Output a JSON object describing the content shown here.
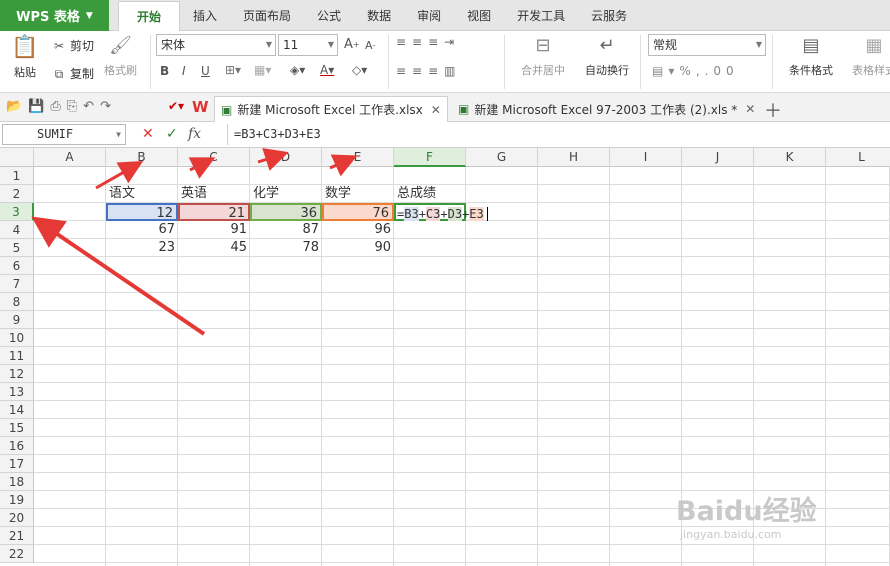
{
  "app": {
    "name": "WPS 表格",
    "menu_tabs": [
      "开始",
      "插入",
      "页面布局",
      "公式",
      "数据",
      "审阅",
      "视图",
      "开发工具",
      "云服务"
    ],
    "active_tab": "开始"
  },
  "ribbon": {
    "paste": "粘贴",
    "cut": "剪切",
    "copy": "复制",
    "format_painter": "格式刷",
    "font_name": "宋体",
    "font_size": "11",
    "merge_center": "合并居中",
    "wrap_text": "自动换行",
    "number_format": "常规",
    "conditional_format": "条件格式",
    "table_style": "表格样式"
  },
  "doc_tabs": [
    {
      "label": "新建 Microsoft Excel 工作表.xlsx",
      "active": true
    },
    {
      "label": "新建 Microsoft Excel 97-2003 工作表 (2).xls *",
      "active": false
    }
  ],
  "formula_bar": {
    "name_box": "SUMIF",
    "formula": "=B3+C3+D3+E3"
  },
  "columns": [
    "A",
    "B",
    "C",
    "D",
    "E",
    "F",
    "G",
    "H",
    "I",
    "J",
    "K",
    "L"
  ],
  "rows": [
    "1",
    "2",
    "3",
    "4",
    "5",
    "6",
    "7",
    "8",
    "9",
    "10",
    "11",
    "12",
    "13",
    "14",
    "15",
    "16",
    "17",
    "18",
    "19",
    "20",
    "21",
    "22"
  ],
  "sheet": {
    "headers": [
      "语文",
      "英语",
      "化学",
      "数学",
      "总成绩"
    ],
    "data": [
      [
        "12",
        "21",
        "36",
        "76"
      ],
      [
        "67",
        "91",
        "87",
        "96"
      ],
      [
        "23",
        "45",
        "78",
        "90"
      ]
    ],
    "editing_formula": {
      "eq": "=",
      "b": "B3",
      "c": "C3",
      "d": "D3",
      "e": "E3",
      "plus": "+"
    }
  },
  "watermark": {
    "text": "Baidu经验",
    "url": "jingyan.baidu.com"
  }
}
